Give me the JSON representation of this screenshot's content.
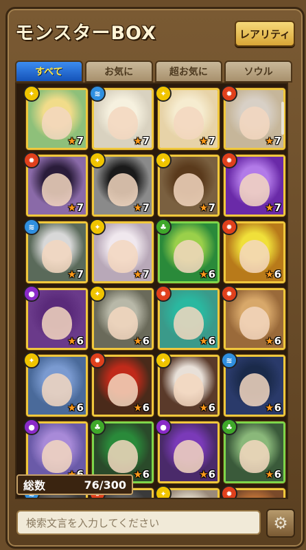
{
  "header": {
    "title": "モンスターBOX",
    "rarity_button": "レアリティ"
  },
  "tabs": [
    {
      "label": "すべて",
      "active": true
    },
    {
      "label": "お気に",
      "active": false
    },
    {
      "label": "超お気に",
      "active": false
    },
    {
      "label": "ソウル",
      "active": false
    }
  ],
  "colors": {
    "fire": "#e0401c",
    "water": "#2f8fe0",
    "wood": "#3fa82a",
    "light": "#f0c400",
    "dark": "#8a2ac8"
  },
  "monsters": [
    {
      "attr": "light",
      "stars": "7",
      "bg": "#8ec07a",
      "hair": "#f1dc8a"
    },
    {
      "attr": "water",
      "stars": "7",
      "bg": "#d9d2c0",
      "hair": "#f6f1df"
    },
    {
      "attr": "light",
      "stars": "7",
      "bg": "#e7d3a8",
      "hair": "#f6ecd0"
    },
    {
      "attr": "fire",
      "stars": "7",
      "bg": "#c6b69a",
      "hair": "#d8d0c6"
    },
    {
      "attr": "fire",
      "stars": "7",
      "bg": "#8a6aa8",
      "hair": "#2a1c3a"
    },
    {
      "attr": "light",
      "stars": "7",
      "bg": "#8a8a8a",
      "hair": "#1a1a1a"
    },
    {
      "attr": "light",
      "stars": "7",
      "bg": "#7a6040",
      "hair": "#5a3a1c"
    },
    {
      "attr": "fire",
      "stars": "7",
      "bg": "#6a2aa8",
      "hair": "#b27ae8"
    },
    {
      "attr": "water",
      "stars": "7",
      "bg": "#5a6a5a",
      "hair": "#d8d8d8"
    },
    {
      "attr": "light",
      "stars": "7",
      "bg": "#b8a8b8",
      "hair": "#f0e8ee"
    },
    {
      "attr": "wood",
      "stars": "6",
      "bg": "#2a8a3a",
      "hair": "#9ad04a"
    },
    {
      "attr": "fire",
      "stars": "6",
      "bg": "#b87a1a",
      "hair": "#f0e03a"
    },
    {
      "attr": "dark",
      "stars": "6",
      "bg": "#6a3a8a",
      "hair": "#5a2a7a"
    },
    {
      "attr": "light",
      "stars": "6",
      "bg": "#6a6a5a",
      "hair": "#b8b8a8"
    },
    {
      "attr": "fire",
      "stars": "6",
      "bg": "#3a9a8a",
      "hair": "#2ab8a0"
    },
    {
      "attr": "fire",
      "stars": "6",
      "bg": "#9a6a3a",
      "hair": "#d8a86a"
    },
    {
      "attr": "light",
      "stars": "6",
      "bg": "#4a6a9a",
      "hair": "#7a9ad0"
    },
    {
      "attr": "fire",
      "stars": "6",
      "bg": "#4a2a1a",
      "hair": "#c02a1a"
    },
    {
      "attr": "light",
      "stars": "6",
      "bg": "#5a3a2a",
      "hair": "#e8e0d8"
    },
    {
      "attr": "water",
      "stars": "6",
      "bg": "#2a3a6a",
      "hair": "#1a2a4a"
    },
    {
      "attr": "dark",
      "stars": "6",
      "bg": "#6a5aa8",
      "hair": "#a88ad8"
    },
    {
      "attr": "wood",
      "stars": "6",
      "bg": "#2a4a2a",
      "hair": "#2a8a3a"
    },
    {
      "attr": "dark",
      "stars": "6",
      "bg": "#4a2a6a",
      "hair": "#7a3ab8"
    },
    {
      "attr": "wood",
      "stars": "6",
      "bg": "#3a5a3a",
      "hair": "#8ab87a"
    },
    {
      "attr": "water",
      "stars": "",
      "bg": "#3a3a3a",
      "hair": "#6a6a6a"
    },
    {
      "attr": "fire",
      "stars": "",
      "bg": "#3a3a3a",
      "hair": "#6a6a6a"
    },
    {
      "attr": "light",
      "stars": "",
      "bg": "#9a8a7a",
      "hair": "#e8e0d0"
    },
    {
      "attr": "fire",
      "stars": "",
      "bg": "#7a4a2a",
      "hair": "#c8783a"
    }
  ],
  "footer": {
    "count_label": "総数",
    "count_value": "76/300",
    "search_placeholder": "検索文言を入力してください"
  }
}
